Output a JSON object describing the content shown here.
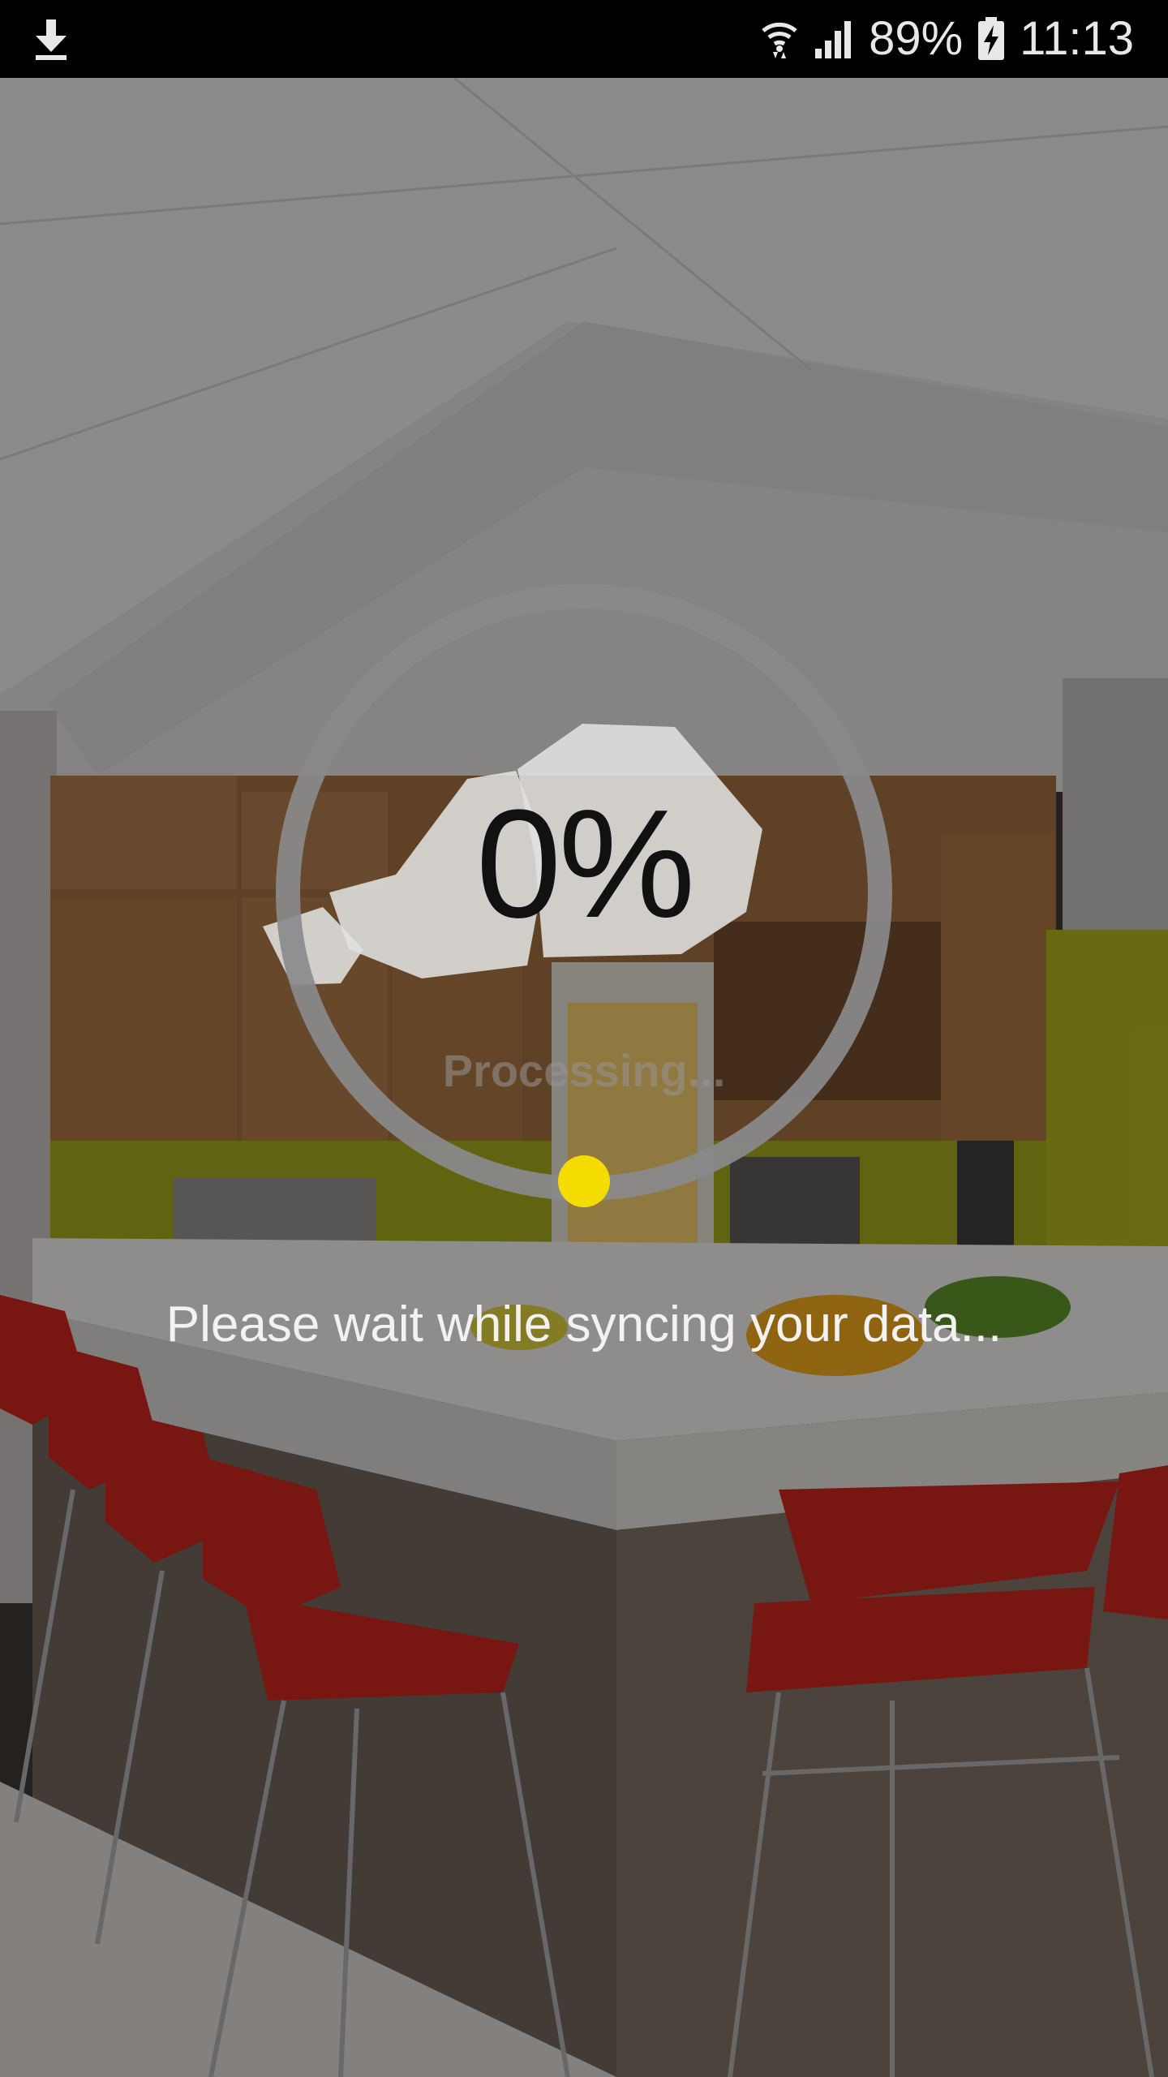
{
  "status_bar": {
    "battery_percent": "89%",
    "time": "11:13",
    "icons": [
      "download-icon",
      "wifi-icon",
      "signal-icon",
      "battery-charging-icon"
    ]
  },
  "sync": {
    "progress_percent": 0,
    "percent_label": "0%",
    "processing_label": "Processing...",
    "message": "Please wait while syncing your data..."
  },
  "colors": {
    "ring": "#8a8a8c",
    "indicator": "#f4dc00",
    "percent_text": "#111111",
    "message_text": "#f2f2f2"
  }
}
